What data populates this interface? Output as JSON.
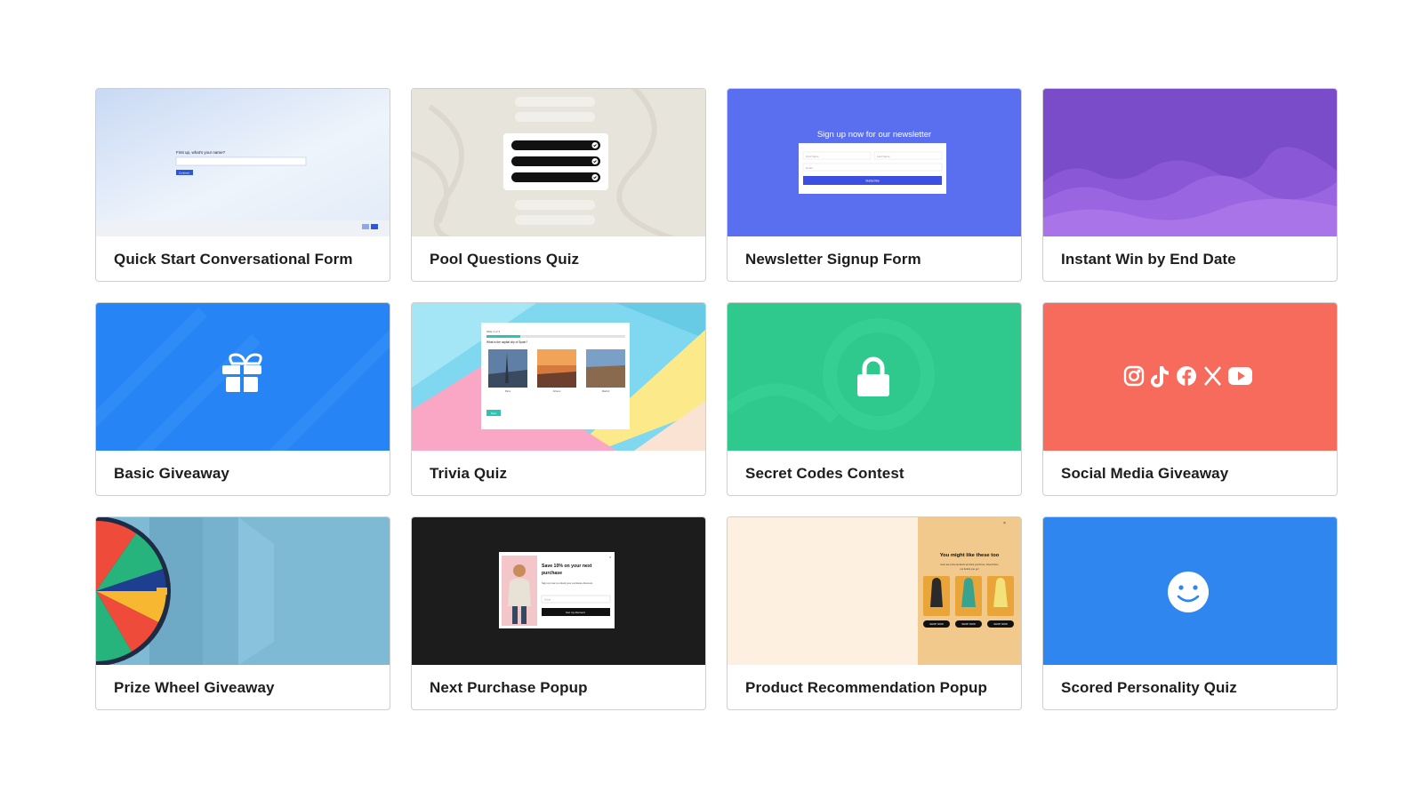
{
  "cards": [
    {
      "title": "Quick Start Conversational Form",
      "preview": {
        "question": "First up, what's your name?",
        "button": "Continue"
      }
    },
    {
      "title": "Pool Questions Quiz"
    },
    {
      "title": "Newsletter Signup Form",
      "preview": {
        "heading": "Sign up now for our newsletter",
        "first_name": "First Name",
        "last_name": "Last Name",
        "email": "Email",
        "button": "Subscribe"
      }
    },
    {
      "title": "Instant Win by End Date"
    },
    {
      "title": "Basic Giveaway",
      "icon": "gift-icon"
    },
    {
      "title": "Trivia Quiz",
      "preview": {
        "progress": "Slide 1 of 3",
        "question": "What is the capital city of Spain?",
        "options": [
          "Paris",
          "Athens",
          "Madrid"
        ],
        "button": "Next"
      }
    },
    {
      "title": "Secret Codes Contest",
      "icon": "lock-icon"
    },
    {
      "title": "Social Media Giveaway",
      "icons": [
        "instagram-icon",
        "tiktok-icon",
        "facebook-icon",
        "x-icon",
        "youtube-icon"
      ]
    },
    {
      "title": "Prize Wheel Giveaway"
    },
    {
      "title": "Next Purchase Popup",
      "preview": {
        "heading": "Save 10% on your next purchase",
        "body": "Sign up now to unlock your exclusive discount.",
        "email": "Email",
        "button": "Get my discount"
      }
    },
    {
      "title": "Product Recommendation Popup",
      "preview": {
        "heading": "You might like these too",
        "body": "Here are a few products we think you'll love. Check them out before you go!",
        "button": "SHOP NOW"
      }
    },
    {
      "title": "Scored Personality Quiz",
      "icon": "smiley-icon"
    }
  ],
  "colors": {
    "newsletter_bg": "#5a6ff0",
    "instant_win_bg": "#7b4cc9",
    "giveaway_bg": "#2784f5",
    "secret_bg": "#2fc88d",
    "social_bg": "#f76b5c",
    "next_purchase_bg": "#1c1c1c",
    "personality_bg": "#2f86ee"
  }
}
